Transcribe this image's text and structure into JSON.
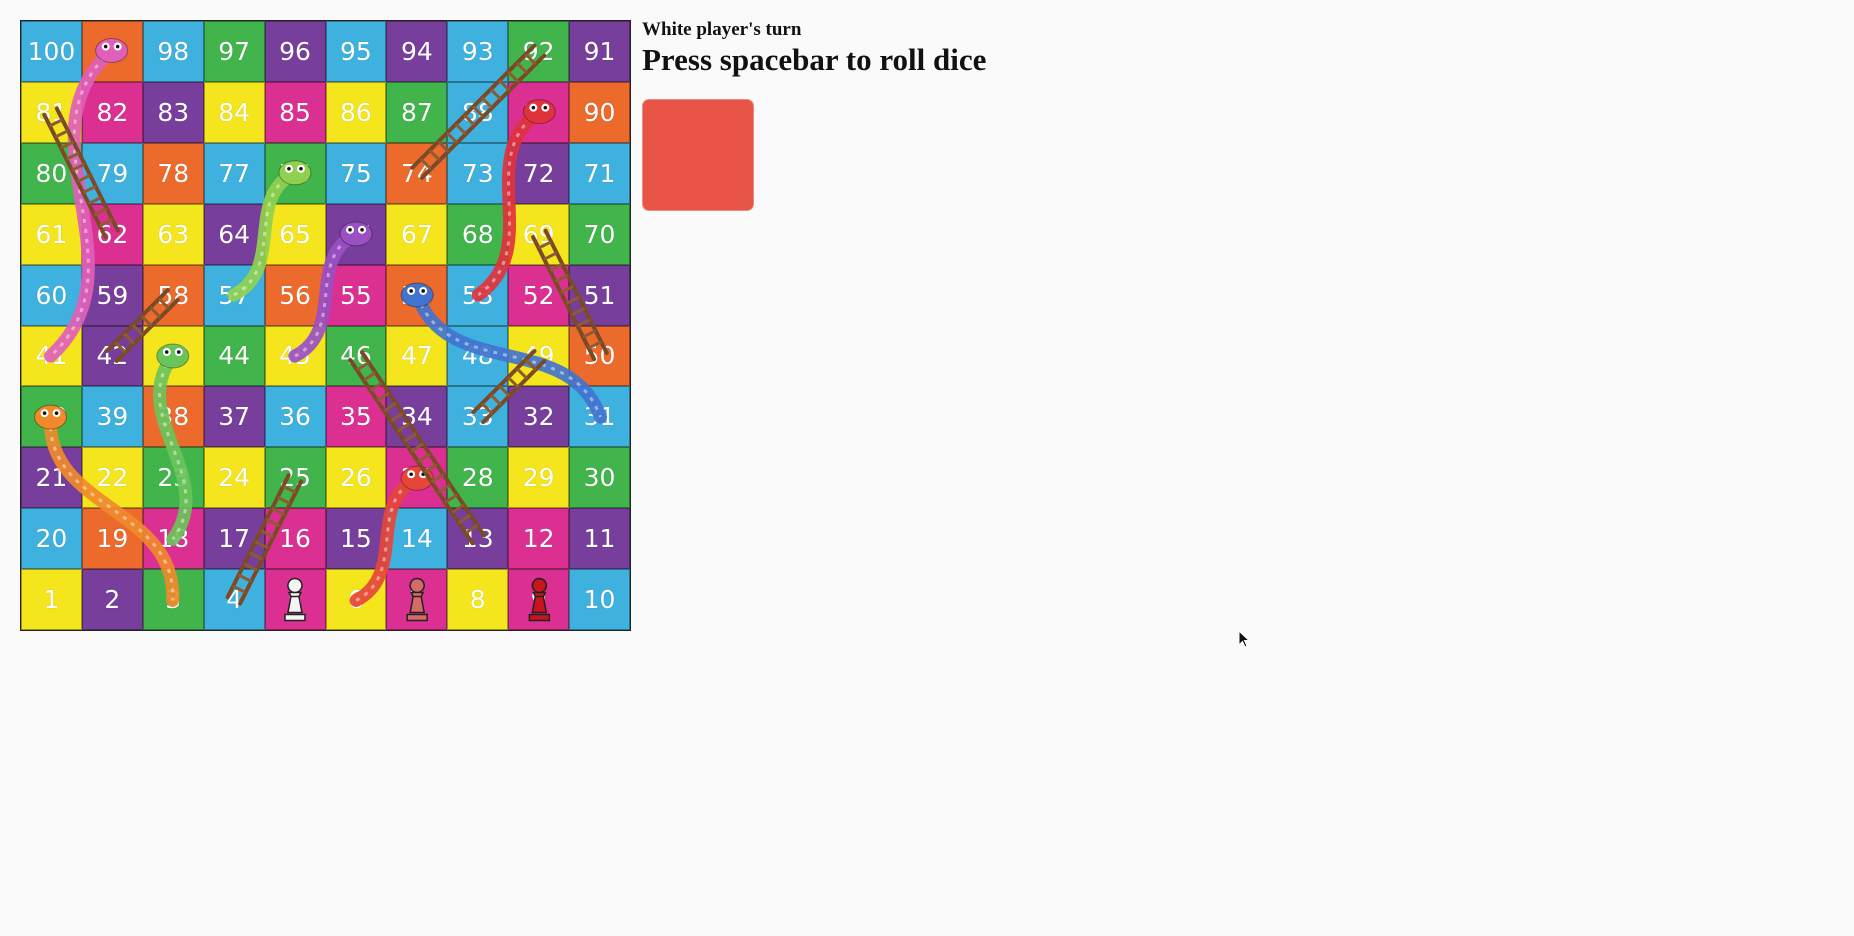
{
  "status": "White player's turn",
  "instruction": "Press spacebar to roll dice",
  "dice": {
    "color": "#e85446"
  },
  "board": {
    "colors": {
      "blue": "#3fb1df",
      "green": "#41b54b",
      "purple": "#773f9b",
      "yellow": "#f5e51c",
      "pink": "#db3092",
      "orange": "#ec6a2c"
    },
    "rows": [
      [
        {
          "n": "100",
          "c": "blue"
        },
        {
          "n": "99",
          "c": "orange"
        },
        {
          "n": "98",
          "c": "blue"
        },
        {
          "n": "97",
          "c": "green"
        },
        {
          "n": "96",
          "c": "purple"
        },
        {
          "n": "95",
          "c": "blue"
        },
        {
          "n": "94",
          "c": "purple"
        },
        {
          "n": "93",
          "c": "blue"
        },
        {
          "n": "92",
          "c": "green"
        },
        {
          "n": "91",
          "c": "purple"
        }
      ],
      [
        {
          "n": "81",
          "c": "yellow"
        },
        {
          "n": "82",
          "c": "pink"
        },
        {
          "n": "83",
          "c": "purple"
        },
        {
          "n": "84",
          "c": "yellow"
        },
        {
          "n": "85",
          "c": "pink"
        },
        {
          "n": "86",
          "c": "yellow"
        },
        {
          "n": "87",
          "c": "green"
        },
        {
          "n": "88",
          "c": "blue"
        },
        {
          "n": "89",
          "c": "pink"
        },
        {
          "n": "90",
          "c": "orange"
        }
      ],
      [
        {
          "n": "80",
          "c": "green"
        },
        {
          "n": "79",
          "c": "blue"
        },
        {
          "n": "78",
          "c": "orange"
        },
        {
          "n": "77",
          "c": "blue"
        },
        {
          "n": "76",
          "c": "green"
        },
        {
          "n": "75",
          "c": "blue"
        },
        {
          "n": "74",
          "c": "orange"
        },
        {
          "n": "73",
          "c": "blue"
        },
        {
          "n": "72",
          "c": "purple"
        },
        {
          "n": "71",
          "c": "blue"
        }
      ],
      [
        {
          "n": "61",
          "c": "yellow"
        },
        {
          "n": "62",
          "c": "pink"
        },
        {
          "n": "63",
          "c": "yellow"
        },
        {
          "n": "64",
          "c": "purple"
        },
        {
          "n": "65",
          "c": "yellow"
        },
        {
          "n": "66",
          "c": "purple"
        },
        {
          "n": "67",
          "c": "yellow"
        },
        {
          "n": "68",
          "c": "green"
        },
        {
          "n": "69",
          "c": "yellow"
        },
        {
          "n": "70",
          "c": "green"
        }
      ],
      [
        {
          "n": "60",
          "c": "blue"
        },
        {
          "n": "59",
          "c": "purple"
        },
        {
          "n": "58",
          "c": "orange"
        },
        {
          "n": "57",
          "c": "blue"
        },
        {
          "n": "56",
          "c": "orange"
        },
        {
          "n": "55",
          "c": "pink"
        },
        {
          "n": "54",
          "c": "orange"
        },
        {
          "n": "53",
          "c": "blue"
        },
        {
          "n": "52",
          "c": "pink"
        },
        {
          "n": "51",
          "c": "purple"
        }
      ],
      [
        {
          "n": "41",
          "c": "yellow"
        },
        {
          "n": "42",
          "c": "purple"
        },
        {
          "n": "43",
          "c": "yellow"
        },
        {
          "n": "44",
          "c": "green"
        },
        {
          "n": "45",
          "c": "yellow"
        },
        {
          "n": "46",
          "c": "green"
        },
        {
          "n": "47",
          "c": "yellow"
        },
        {
          "n": "48",
          "c": "blue"
        },
        {
          "n": "49",
          "c": "yellow"
        },
        {
          "n": "50",
          "c": "orange"
        }
      ],
      [
        {
          "n": "40",
          "c": "green"
        },
        {
          "n": "39",
          "c": "blue"
        },
        {
          "n": "38",
          "c": "orange"
        },
        {
          "n": "37",
          "c": "purple"
        },
        {
          "n": "36",
          "c": "blue"
        },
        {
          "n": "35",
          "c": "pink"
        },
        {
          "n": "34",
          "c": "purple"
        },
        {
          "n": "33",
          "c": "blue"
        },
        {
          "n": "32",
          "c": "purple"
        },
        {
          "n": "31",
          "c": "blue"
        }
      ],
      [
        {
          "n": "21",
          "c": "purple"
        },
        {
          "n": "22",
          "c": "yellow"
        },
        {
          "n": "23",
          "c": "green"
        },
        {
          "n": "24",
          "c": "yellow"
        },
        {
          "n": "25",
          "c": "green"
        },
        {
          "n": "26",
          "c": "yellow"
        },
        {
          "n": "27",
          "c": "pink"
        },
        {
          "n": "28",
          "c": "green"
        },
        {
          "n": "29",
          "c": "yellow"
        },
        {
          "n": "30",
          "c": "green"
        }
      ],
      [
        {
          "n": "20",
          "c": "blue"
        },
        {
          "n": "19",
          "c": "orange"
        },
        {
          "n": "18",
          "c": "pink"
        },
        {
          "n": "17",
          "c": "purple"
        },
        {
          "n": "16",
          "c": "pink"
        },
        {
          "n": "15",
          "c": "purple"
        },
        {
          "n": "14",
          "c": "blue"
        },
        {
          "n": "13",
          "c": "purple"
        },
        {
          "n": "12",
          "c": "pink"
        },
        {
          "n": "11",
          "c": "purple"
        }
      ],
      [
        {
          "n": "1",
          "c": "yellow"
        },
        {
          "n": "2",
          "c": "purple"
        },
        {
          "n": "3",
          "c": "green"
        },
        {
          "n": "4",
          "c": "blue"
        },
        {
          "n": "5",
          "c": "pink"
        },
        {
          "n": "6",
          "c": "yellow"
        },
        {
          "n": "7",
          "c": "pink"
        },
        {
          "n": "8",
          "c": "yellow"
        },
        {
          "n": "9",
          "c": "pink"
        },
        {
          "n": "10",
          "c": "blue"
        }
      ]
    ]
  },
  "pieces": [
    {
      "name": "white-pawn-icon",
      "square": 5,
      "color": "#f4f4f4"
    },
    {
      "name": "red-pawn-icon",
      "square": 7,
      "color": "#d66a66"
    },
    {
      "name": "dark-red-pawn-icon",
      "square": 9,
      "color": "#c8141c"
    }
  ],
  "snakes": [
    {
      "name": "snake-pink-icon",
      "head": 99,
      "tail": 41,
      "color": "#e05fb8"
    },
    {
      "name": "snake-green-icon",
      "head": 76,
      "tail": 57,
      "color": "#8fd14f"
    },
    {
      "name": "snake-purple-icon",
      "head": 66,
      "tail": 45,
      "color": "#9a4fc3"
    },
    {
      "name": "snake-red-icon",
      "head": 89,
      "tail": 53,
      "color": "#e0323c"
    },
    {
      "name": "snake-blue-icon",
      "head": 54,
      "tail": 31,
      "color": "#4173cf"
    },
    {
      "name": "snake-lime-icon",
      "head": 43,
      "tail": 18,
      "color": "#6ac45a"
    },
    {
      "name": "snake-orange-icon",
      "head": 40,
      "tail": 3,
      "color": "#f08a2a"
    },
    {
      "name": "snake-striped-icon",
      "head": 27,
      "tail": 6,
      "color": "#e6453a"
    }
  ],
  "ladders": [
    {
      "name": "ladder-icon",
      "from": 62,
      "to": 81
    },
    {
      "name": "ladder-icon",
      "from": 42,
      "to": 58
    },
    {
      "name": "ladder-icon",
      "from": 74,
      "to": 92
    },
    {
      "name": "ladder-icon",
      "from": 50,
      "to": 69
    },
    {
      "name": "ladder-icon",
      "from": 33,
      "to": 49
    },
    {
      "name": "ladder-icon",
      "from": 13,
      "to": 46
    },
    {
      "name": "ladder-icon",
      "from": 4,
      "to": 25
    }
  ]
}
